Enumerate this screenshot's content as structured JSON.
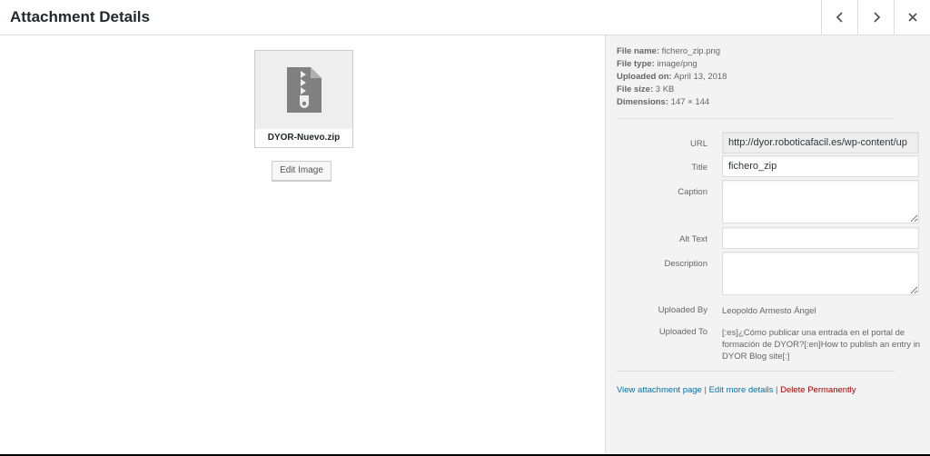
{
  "header": {
    "title": "Attachment Details",
    "prev_icon": "chevron-left-icon",
    "next_icon": "chevron-right-icon",
    "close_icon": "close-icon"
  },
  "preview": {
    "file_label": "DYOR-Nuevo.zip",
    "icon": "zip-file-icon",
    "edit_button": "Edit Image"
  },
  "details": {
    "file_name_label": "File name:",
    "file_name": "fichero_zip.png",
    "file_type_label": "File type:",
    "file_type": "image/png",
    "uploaded_on_label": "Uploaded on:",
    "uploaded_on": "April 13, 2018",
    "file_size_label": "File size:",
    "file_size": "3 KB",
    "dimensions_label": "Dimensions:",
    "dimensions": "147 × 144"
  },
  "form": {
    "url_label": "URL",
    "url_value": "http://dyor.roboticafacil.es/wp-content/up",
    "title_label": "Title",
    "title_value": "fichero_zip",
    "caption_label": "Caption",
    "caption_value": "",
    "alt_label": "Alt Text",
    "alt_value": "",
    "description_label": "Description",
    "description_value": "",
    "uploaded_by_label": "Uploaded By",
    "uploaded_by": "Leopoldo Armesto Ángel",
    "uploaded_to_label": "Uploaded To",
    "uploaded_to": "[:es]¿Cómo publicar una entrada en el portal de formación de DYOR?[:en]How to publish an entry in DYOR Blog site[:]"
  },
  "actions": {
    "view_page": "View attachment page",
    "separator": "|",
    "edit_details": "Edit more details",
    "delete": "Delete Permanently"
  },
  "colors": {
    "link": "#0073aa",
    "danger": "#a00000",
    "sidebar_bg": "#f3f3f3"
  }
}
